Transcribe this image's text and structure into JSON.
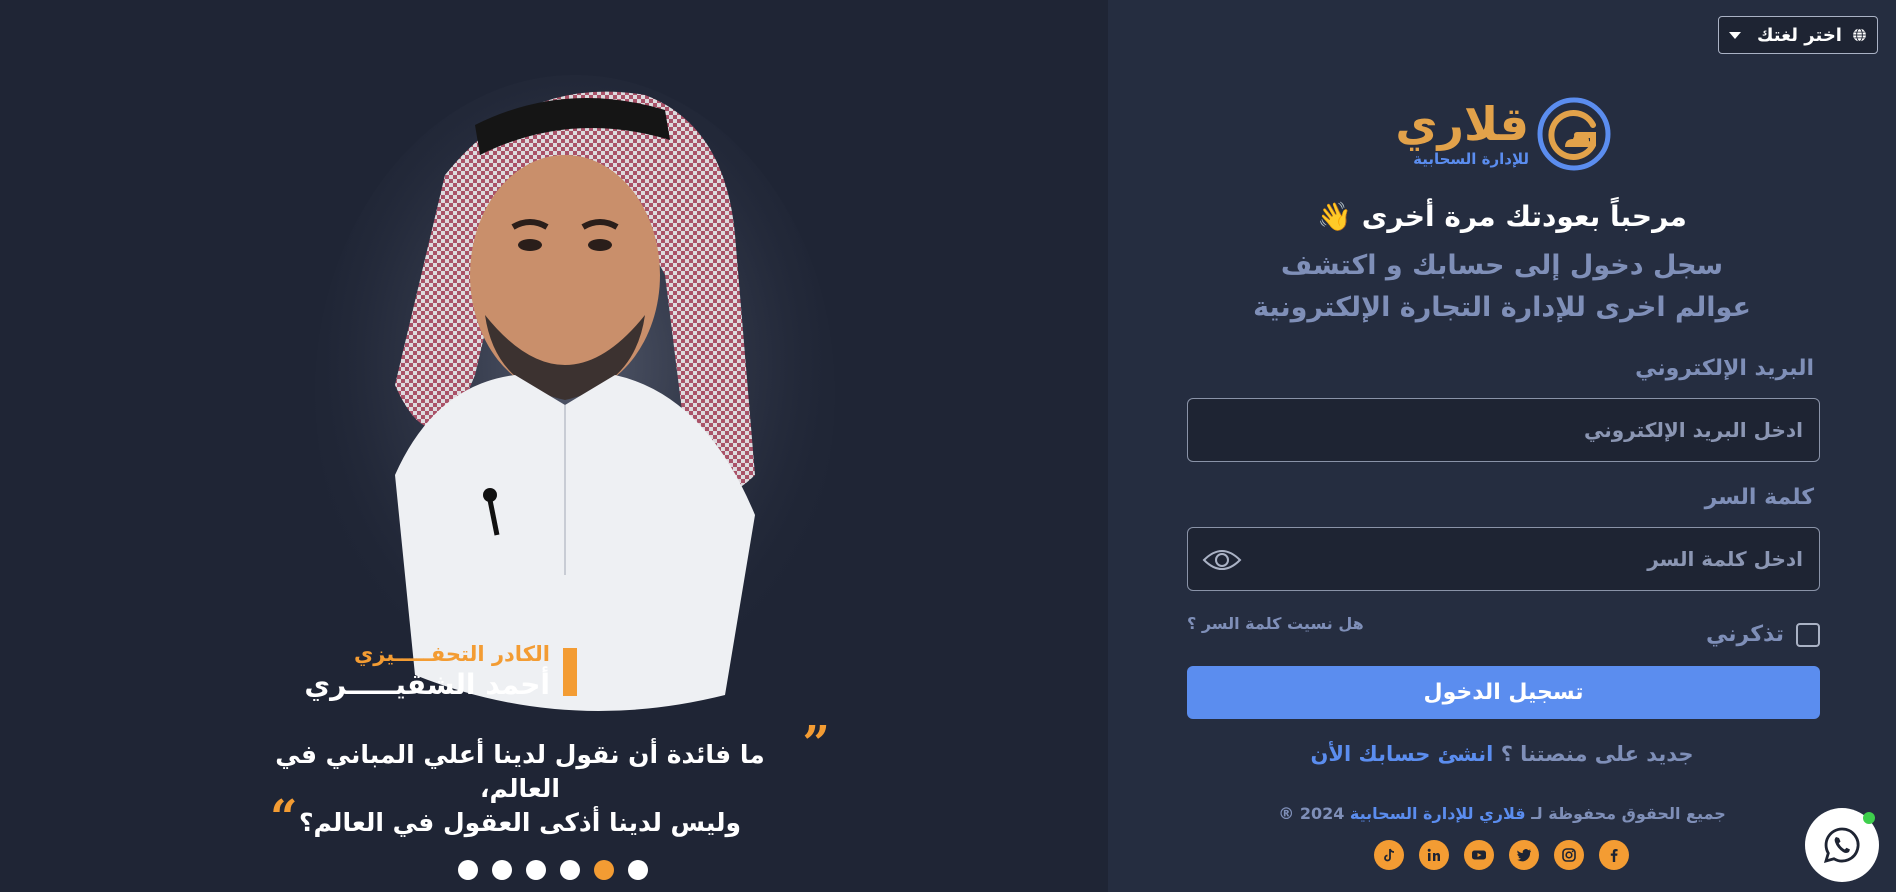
{
  "language": {
    "label": "اختر لغتك",
    "icon": "globe-icon"
  },
  "brand": {
    "name": "قلاري",
    "tagline": "للإدارة السحابية",
    "accent": "#e2a24a",
    "blue": "#5b8def"
  },
  "login": {
    "welcome": "مرحباً بعودتك مرة أخرى 👋",
    "subtitle_line1": "سجل دخول إلى حسابك و اكتشف",
    "subtitle_line2": "عوالم اخرى للإدارة التجارة الإلكترونية",
    "email_label": "البريد الإلكتروني",
    "email_placeholder": "ادخل البريد الإلكتروني",
    "password_label": "كلمة السر",
    "password_placeholder": "ادخل كلمة السر",
    "remember_label": "تذكرني",
    "forgot_link": "هل نسيت كلمة السر ؟",
    "submit_label": "تسجيل الدخول",
    "signup_question": "جديد على منصتنا ؟",
    "signup_link": "انشئ حسابك الأن"
  },
  "footer": {
    "copyright_prefix": "جميع الحقوق محفوظة لـ",
    "copyright_brand": "قلاري للإدارة السحابية",
    "copyright_suffix": "2024 ®",
    "socials": [
      "facebook-icon",
      "instagram-icon",
      "twitter-icon",
      "youtube-icon",
      "linkedin-icon",
      "tiktok-icon"
    ]
  },
  "testimonial": {
    "role": "الكادر التحفـــــيزي",
    "name": "أحمد الشقيـــــري",
    "quote_line1": "ما فائدة أن نقول لدينا أعلي المباني في العالم،",
    "quote_line2": "وليس لدينا أذكى العقول في العالم؟",
    "slides": 6,
    "active_slide": 2
  }
}
